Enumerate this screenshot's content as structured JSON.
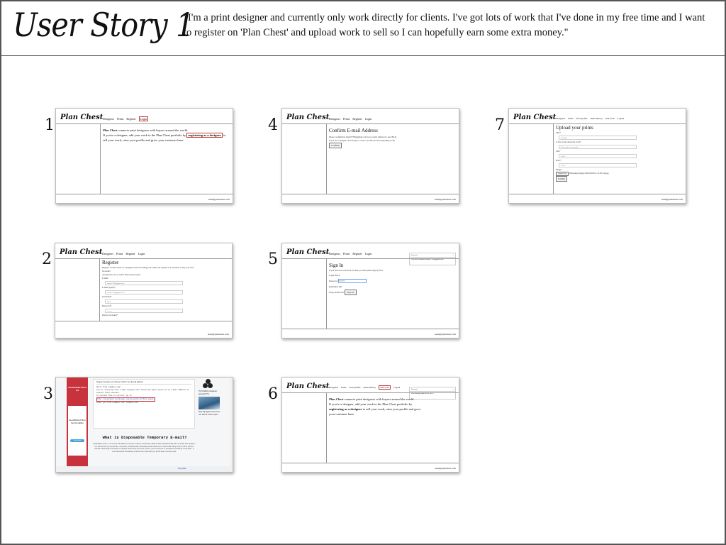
{
  "header": {
    "title": "User Story 1",
    "story": "\"I'm a print designer and currently only work directly for clients. I've got lots of work that I've done in my free time and I want to register on 'Plan Chest' and upload work to sell so I can hopefully earn some extra money.\""
  },
  "common": {
    "brand": "Plan Chest",
    "footer_email": "team@planchest.com"
  },
  "steps": [
    {
      "number": "1",
      "nav": [
        "Designers",
        "Prints",
        "Register",
        "Login"
      ],
      "intro_brand": "Plan Chest",
      "intro_rest": " connects print designers with buyers around the world.",
      "line2_pre": "If you're a designer, add your work to the Plan Chest portfolio by",
      "cta": "registering as a designer",
      "line2_post": " to sell your work, raise your profile and grow your customer base."
    },
    {
      "number": "2",
      "nav": [
        "Designers",
        "Prints",
        "Register",
        "Login"
      ],
      "heading": "Register",
      "text": "Register on Plan Chest as a designer and start selling your prints! Or register as a customer to buy your next favourite!",
      "already": "Already have an account? Then please log in.",
      "fields": [
        {
          "label": "E-mail*",
          "value": "fusrm7738@jgmail.com"
        },
        {
          "label": "E-mail (again)*",
          "value": "fusrm7738@jgmail.com"
        },
        {
          "label": "Username*",
          "value": "Bri-E"
        },
        {
          "label": "Password*",
          "value": "••••••••"
        },
        {
          "label": "Password (again)*",
          "value": ""
        }
      ]
    },
    {
      "number": "3",
      "ad_top": "ADVERTISE WITH US",
      "ad_brand": "the ABSOLUTE in the Tempfiller",
      "ad_button": "Learn more",
      "mail_from": "Subject: Example.com Please Confirm Your E-mail Address",
      "mail_lines": [
        "Hello from example.com!",
        "You're receiving this e-mail because user fusrm has given yours as an e-mail address to connect their account.",
        "To confirm this is correct, go to"
      ],
      "mail_link": "http://planchest.herokuapp.com/accounts/confirm-email/",
      "mail_thanks": "Thank you from example.com! example.com",
      "heading": "What is Disposable Temporary E-mail?",
      "paragraph": "Disposable email - is a service that allows to receive email at a temporary address that self-destructed after a certain time elapses. It is also known by names like : tempmail, 10minutemail, throwaway email, fake-mail or trash-mail. Many forums, Wi-Fi owners, websites and blogs ask visitors to register before they can view content, post comments or download something. Temp-Mail - is most advanced throwaway email service that helps you avoid spam and stay safe.",
      "side_news": "[?] POWER Invitational, guarantij [??] ...",
      "side_caption": "Stad häjr tjgaret Kommuner och häft att udsnir, Sport...",
      "footer_mark": "Temp Mail"
    },
    {
      "number": "4",
      "nav": [
        "Designers",
        "Prints",
        "Register",
        "Login"
      ],
      "heading": "Confirm E-mail Address",
      "text": "Please confirm that fusrm7738@jgmail.com is an e-mail address for user Bri-E.",
      "note": "If you are a designer, don't forget to create a profile and start uploading work!",
      "button": "Confirm"
    },
    {
      "number": "5",
      "nav": [
        "Designers",
        "Prints",
        "Register",
        "Login"
      ],
      "toast_title": "Success!",
      "toast_text": "You have confirmed fusrm7738@jgmail.com.",
      "heading": "Sign In",
      "text": "If you have not created an account yet, then please sign up first.",
      "login_label": "Login:",
      "login_value": "Bri-E",
      "password_label": "Password:",
      "password_value": "••••••••",
      "remember": "Remember Me:",
      "forgot": "Forgot Password?",
      "button": "Sign In"
    },
    {
      "number": "6",
      "nav": [
        "Designers",
        "Prints",
        "Your profile",
        "Order history"
      ],
      "nav_highlight": "Add work",
      "nav_last": "Logout",
      "toast_title": "Success!",
      "toast_text": "Successfully signed in as Bri-E.",
      "intro_brand": "Plan Chest",
      "intro_rest": " connects print designers with buyers around the world.",
      "line2_pre": "If you're a designer, add your work to the Plan Chest portfolio by",
      "cta": "registering as a designer",
      "line2_post": " to sell your work, raise your profile and grow your customer base."
    },
    {
      "number": "7",
      "nav": [
        "Designers",
        "Prints",
        "Your profile",
        "Order history",
        "Add work",
        "Logout"
      ],
      "heading": "Upload your prints",
      "fields": [
        {
          "label": "Title*",
          "value": "Sunlight"
        },
        {
          "label": "A few words about the work*",
          "value": "This work is an example"
        },
        {
          "label": "Size*",
          "value": "30x30"
        },
        {
          "label": "Price*",
          "value": "35.00"
        }
      ],
      "image_label": "Image*",
      "file_button": "Choose File",
      "file_name": "WhatsApp Image 2020-06-08 at 15.20.54.jpeg",
      "submit": "Submit"
    }
  ]
}
